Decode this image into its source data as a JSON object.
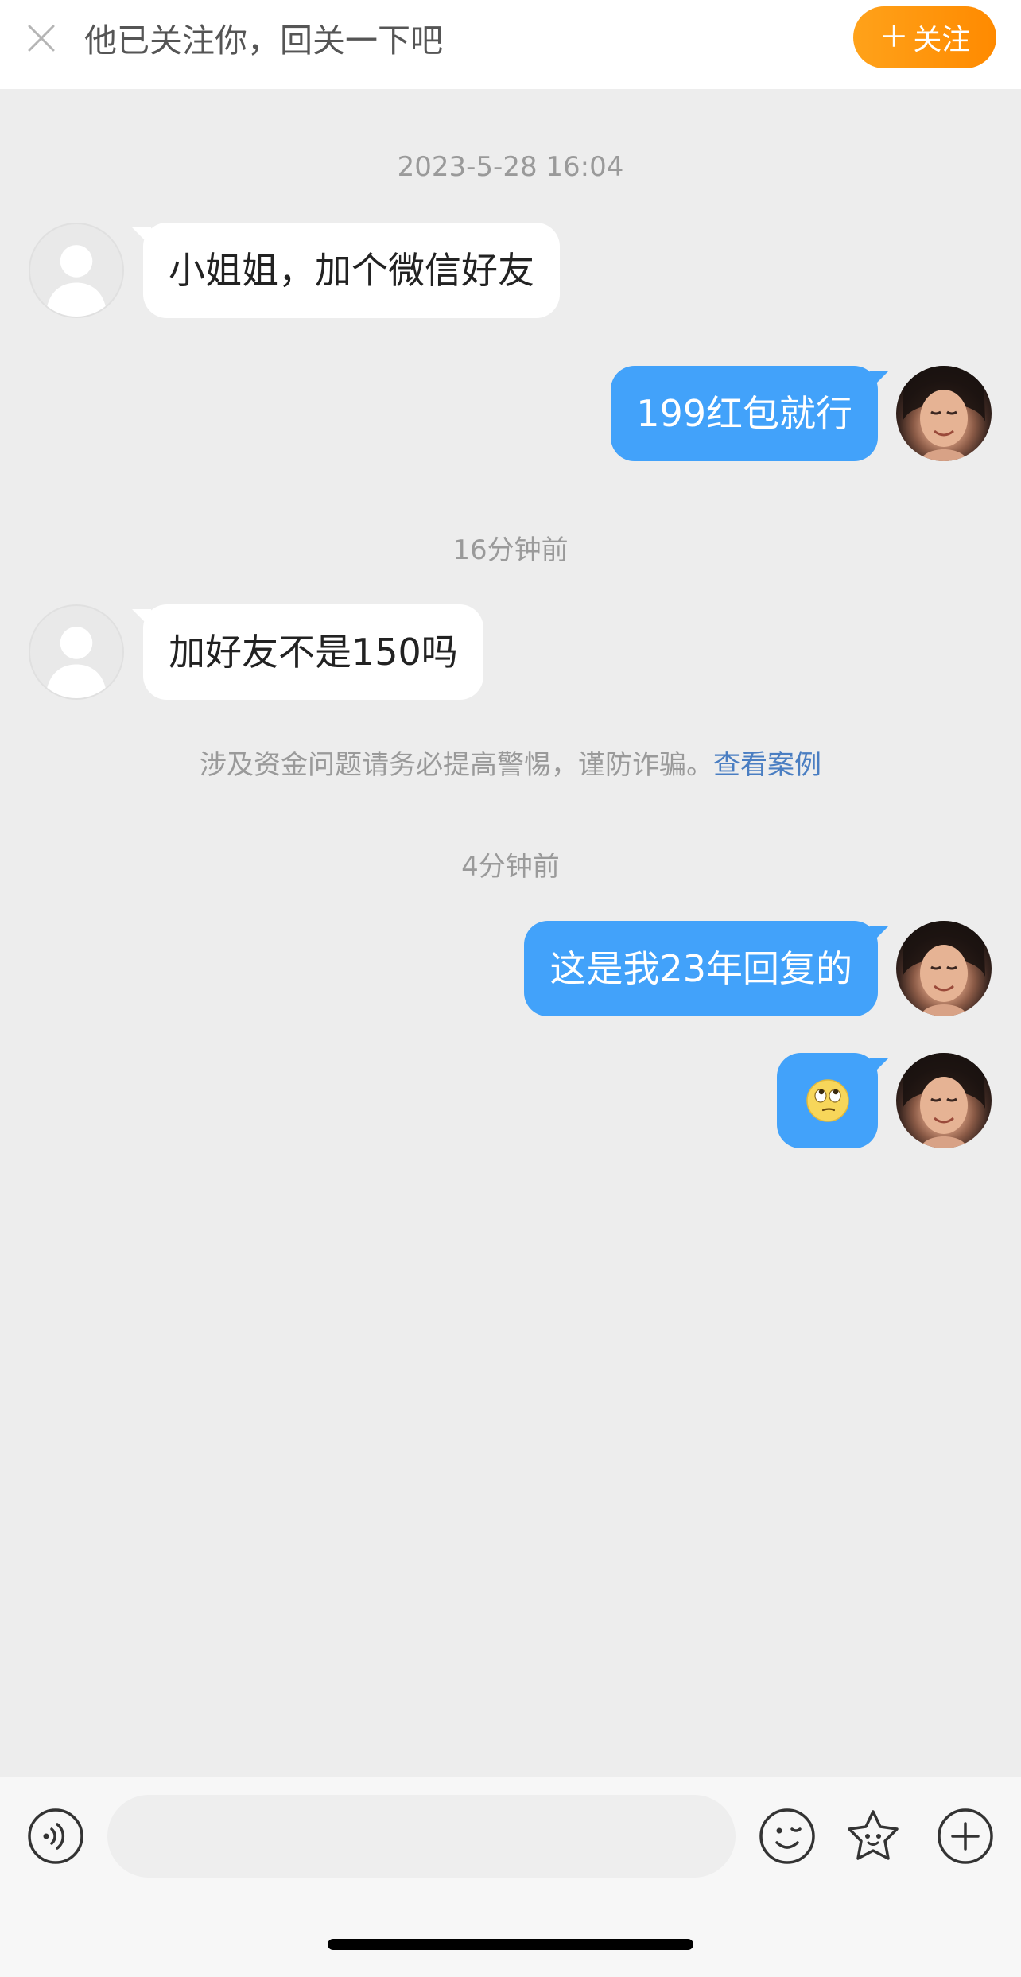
{
  "topbar": {
    "notice": "他已关注你，回关一下吧",
    "follow_label": "关注",
    "follow_plus": "+"
  },
  "timestamps": {
    "first": "2023-5-28 16:04",
    "second": "16分钟前",
    "third": "4分钟前"
  },
  "messages": [
    {
      "side": "in",
      "text": "小姐姐，加个微信好友"
    },
    {
      "side": "out",
      "text": "199红包就行"
    },
    {
      "side": "in",
      "text": "加好友不是150吗"
    },
    {
      "side": "out",
      "text": "这是我23年回复的"
    },
    {
      "side": "out",
      "text": "",
      "emoji": "eye-roll-emoji"
    }
  ],
  "warning": {
    "text": "涉及资金问题请务必提高警惕，谨防诈骗。",
    "link": "查看案例"
  },
  "inputbar": {
    "placeholder": "",
    "icons": [
      "voice-icon",
      "emoji-icon",
      "sticker-icon",
      "plus-icon"
    ]
  },
  "colors": {
    "accent_orange": "#ff9310",
    "bubble_out": "#42a2fa",
    "bubble_in": "#ffffff",
    "background": "#ededed",
    "link": "#4a7ec2"
  }
}
